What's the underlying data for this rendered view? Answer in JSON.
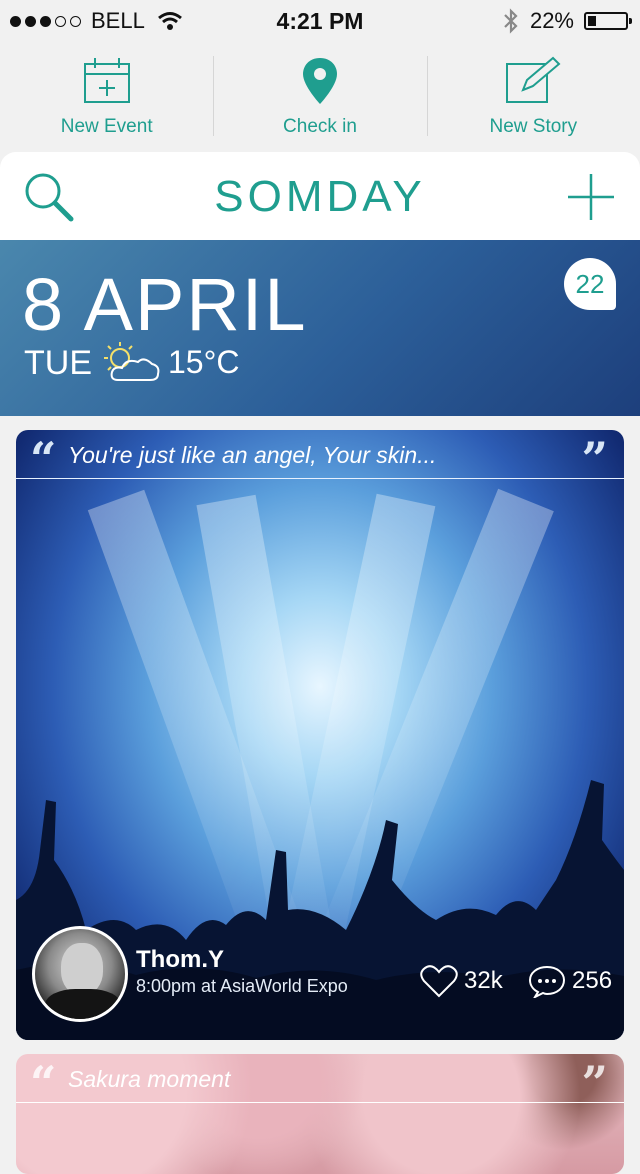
{
  "status_bar": {
    "carrier": "BELL",
    "time": "4:21 PM",
    "battery_percent": "22%",
    "battery_level": 0.22,
    "signal_dots_filled": 3,
    "signal_dots_total": 5
  },
  "quick_actions": [
    {
      "label": "New Event",
      "icon": "calendar-add-icon"
    },
    {
      "label": "Check in",
      "icon": "location-pin-icon"
    },
    {
      "label": "New Story",
      "icon": "edit-note-icon"
    }
  ],
  "header": {
    "title": "SOMDAY",
    "search_icon": "search-icon",
    "add_icon": "plus-icon"
  },
  "date_banner": {
    "date": "8 APRIL",
    "weekday": "TUE",
    "weather_icon": "partly-sunny-icon",
    "temperature": "15°C",
    "badge_count": "22"
  },
  "feed": [
    {
      "quote": "You're just like an angel, Your skin...",
      "author": "Thom.Y",
      "meta": "8:00pm at AsiaWorld Expo",
      "likes": "32k",
      "comments": "256"
    },
    {
      "quote": "Sakura moment"
    }
  ],
  "colors": {
    "accent": "#1f9e8f",
    "banner_blue": "#2c5f99"
  }
}
